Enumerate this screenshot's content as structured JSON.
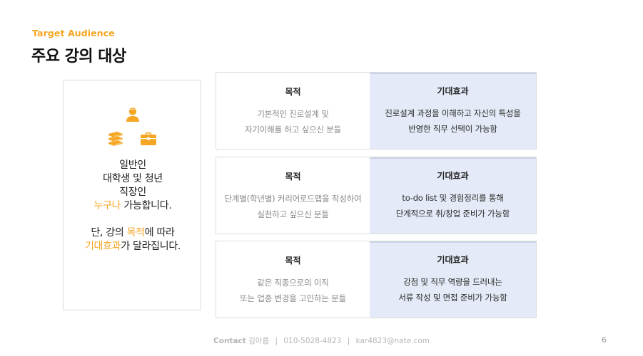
{
  "header": {
    "eyebrow": "Target Audience",
    "title": "주요 강의 대상"
  },
  "audience": {
    "icons": [
      "person-icon",
      "books-icon",
      "briefcase-icon"
    ],
    "accent_color": "#f5a623",
    "line1": "일반인",
    "line2": "대학생 및 청년",
    "line3": "직장인",
    "line4_highlight": "누구나",
    "line4_rest": " 가능합니다.",
    "line5_pre": "단, 강의 ",
    "line5_highlight": "목적",
    "line5_post": "에 따라",
    "line6_highlight": "기대효과",
    "line6_post": "가 달라집니다."
  },
  "rows": [
    {
      "goal_title": "목적",
      "goal_line1": "기본적인 진로설계 및",
      "goal_line2": "자기이해를 하고 싶으신 분들",
      "effect_title": "기대효과",
      "effect_line1": "진로설계 과정을 이해하고 자신의 특성을",
      "effect_line2": "반영한 직무 선택이 가능함"
    },
    {
      "goal_title": "목적",
      "goal_line1": "단계별(학년별) 커리어로드맵을 작성하여",
      "goal_line2": "실천하고 싶으신 분들",
      "effect_title": "기대효과",
      "effect_line1": "to-do list 및 경험정리를 통해",
      "effect_line2": "단계적으로 취/창업 준비가 가능함"
    },
    {
      "goal_title": "목적",
      "goal_line1": "같은 직종으로의 이직",
      "goal_line2": "또는 업종 변경을 고민하는 분들",
      "effect_title": "기대효과",
      "effect_line1": "강점 및 직무 역량을 드러내는",
      "effect_line2": "서류 작성 및 면접 준비가 가능함"
    }
  ],
  "footer": {
    "contact_label": "Contact",
    "name": "김아름",
    "phone": "010-5028-4823",
    "email": "kar4823@nate.com",
    "separator": "|",
    "page_number": "6"
  }
}
